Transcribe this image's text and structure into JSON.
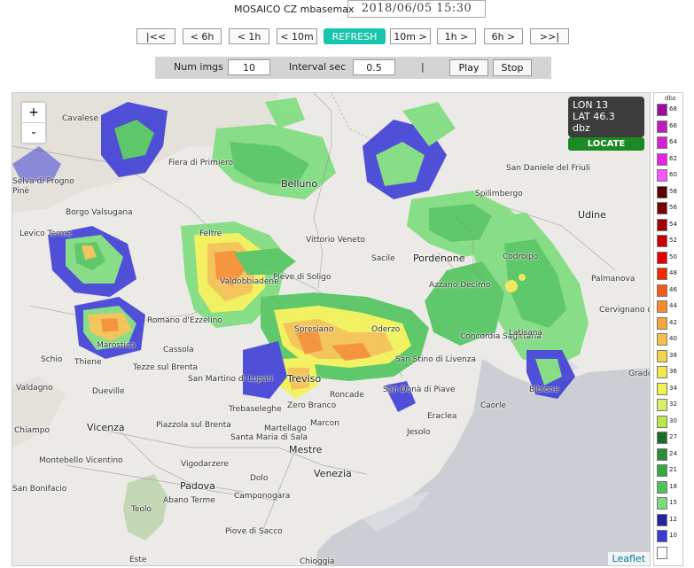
{
  "header": {
    "title": "MOSAICO CZ mbasemax",
    "datetime": "2018/06/05 15:30"
  },
  "nav_buttons": [
    {
      "label": "|<<",
      "name": "first-button"
    },
    {
      "label": "< 6h",
      "name": "back-6h-button"
    },
    {
      "label": "< 1h",
      "name": "back-1h-button"
    },
    {
      "label": "< 10m",
      "name": "back-10m-button"
    },
    {
      "label": "REFRESH",
      "name": "refresh-button"
    },
    {
      "label": "10m >",
      "name": "fwd-10m-button"
    },
    {
      "label": "1h >",
      "name": "fwd-1h-button"
    },
    {
      "label": "6h >",
      "name": "fwd-6h-button"
    },
    {
      "label": ">>|",
      "name": "last-button"
    }
  ],
  "controls": {
    "num_imgs_label": "Num imgs",
    "num_imgs_value": "10",
    "interval_label": "Interval sec",
    "interval_value": "0.5",
    "separator": "|",
    "play_label": "Play",
    "stop_label": "Stop"
  },
  "map": {
    "zoom_in": "+",
    "zoom_out": "-",
    "info": {
      "lon": "LON 13",
      "lat": "LAT 46.3",
      "unit": "dbz"
    },
    "locate_label": "LOCATE",
    "attribution": "Leaflet",
    "places": [
      {
        "name": "Cavalese"
      },
      {
        "name": "Fiera di Primiero"
      },
      {
        "name": "Belluno"
      },
      {
        "name": "Udine"
      },
      {
        "name": "San Daniele del Friuli"
      },
      {
        "name": "Spilimbergo"
      },
      {
        "name": "Borgo Valsugana"
      },
      {
        "name": "Levico Terme"
      },
      {
        "name": "Feltre"
      },
      {
        "name": "Vittorio Veneto"
      },
      {
        "name": "Sacile"
      },
      {
        "name": "Pordenone"
      },
      {
        "name": "Codroipo"
      },
      {
        "name": "Palmanova"
      },
      {
        "name": "Pieve di Soligo"
      },
      {
        "name": "Valdobbiadene"
      },
      {
        "name": "Azzano Decimo"
      },
      {
        "name": "Cervignano del Friuli"
      },
      {
        "name": "Romano d'Ezzelino"
      },
      {
        "name": "Marostica"
      },
      {
        "name": "Cassola"
      },
      {
        "name": "Spresiano"
      },
      {
        "name": "Oderzo"
      },
      {
        "name": "Concordia Sagittaria"
      },
      {
        "name": "Latisana"
      },
      {
        "name": "Schio"
      },
      {
        "name": "Thiene"
      },
      {
        "name": "Tezze sul Brenta"
      },
      {
        "name": "San Martino di Lupari"
      },
      {
        "name": "Treviso"
      },
      {
        "name": "Roncade"
      },
      {
        "name": "San Donà di Piave"
      },
      {
        "name": "San Stino di Livenza"
      },
      {
        "name": "Bibione"
      },
      {
        "name": "Grado"
      },
      {
        "name": "Valdagno"
      },
      {
        "name": "Dueville"
      },
      {
        "name": "Trebaseleghe"
      },
      {
        "name": "Zero Branco"
      },
      {
        "name": "Eraclea"
      },
      {
        "name": "Caorle"
      },
      {
        "name": "Vicenza"
      },
      {
        "name": "Piazzola sul Brenta"
      },
      {
        "name": "Martellago"
      },
      {
        "name": "Marcon"
      },
      {
        "name": "Jesolo"
      },
      {
        "name": "Chiampo"
      },
      {
        "name": "Santa Maria di Sala"
      },
      {
        "name": "Mestre"
      },
      {
        "name": "Montebello Vicentino"
      },
      {
        "name": "Vigodarzere"
      },
      {
        "name": "Venezia"
      },
      {
        "name": "San Bonifacio"
      },
      {
        "name": "Padova"
      },
      {
        "name": "Dolo"
      },
      {
        "name": "Abano Terme"
      },
      {
        "name": "Teolo"
      },
      {
        "name": "Camponogara"
      },
      {
        "name": "Piove di Sacco"
      },
      {
        "name": "Este"
      },
      {
        "name": "Chioggia"
      },
      {
        "name": "Selva di Progno"
      },
      {
        "name": "Pinè"
      }
    ]
  },
  "legend": {
    "unit": "dbz",
    "levels": [
      {
        "v": "68",
        "c": "#9e0b9e"
      },
      {
        "v": "66",
        "c": "#bf1bbf"
      },
      {
        "v": "64",
        "c": "#d61fd6"
      },
      {
        "v": "62",
        "c": "#ec1fec"
      },
      {
        "v": "60",
        "c": "#ff55ff"
      },
      {
        "v": "58",
        "c": "#5b0000"
      },
      {
        "v": "56",
        "c": "#7a0000"
      },
      {
        "v": "54",
        "c": "#a30000"
      },
      {
        "v": "52",
        "c": "#c80000"
      },
      {
        "v": "50",
        "c": "#e30000"
      },
      {
        "v": "48",
        "c": "#f22a00"
      },
      {
        "v": "46",
        "c": "#f55a1a"
      },
      {
        "v": "44",
        "c": "#f78a2a"
      },
      {
        "v": "42",
        "c": "#f7a540"
      },
      {
        "v": "40",
        "c": "#f5c04a"
      },
      {
        "v": "38",
        "c": "#f2d64b"
      },
      {
        "v": "36",
        "c": "#efe84c"
      },
      {
        "v": "34",
        "c": "#f2f250"
      },
      {
        "v": "32",
        "c": "#d9ee6a"
      },
      {
        "v": "30",
        "c": "#b8e84a"
      },
      {
        "v": "27",
        "c": "#1d6b2b"
      },
      {
        "v": "24",
        "c": "#2b8c38"
      },
      {
        "v": "21",
        "c": "#35a843"
      },
      {
        "v": "18",
        "c": "#4cc45a"
      },
      {
        "v": "15",
        "c": "#7bdc7b"
      },
      {
        "v": "12",
        "c": "#2424a0"
      },
      {
        "v": "10",
        "c": "#3a3ad6"
      },
      {
        "v": "",
        "c": "#ffffff"
      }
    ]
  }
}
